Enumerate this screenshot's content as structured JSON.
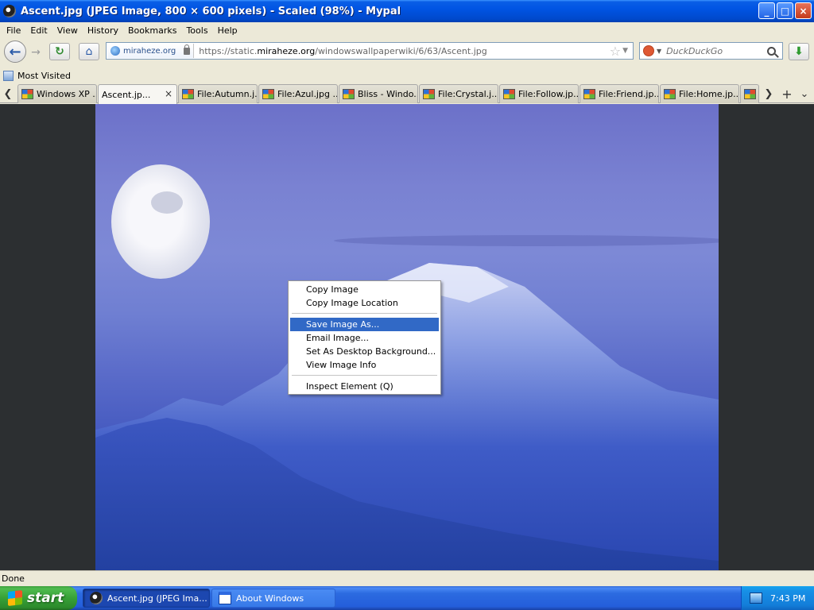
{
  "window": {
    "title": "Ascent.jpg (JPEG Image, 800 × 600 pixels) - Scaled (98%) - Mypal",
    "buttons": {
      "minimize": "_",
      "maximize": "□",
      "close": "×"
    }
  },
  "menubar": {
    "items": [
      {
        "label": "File"
      },
      {
        "label": "Edit"
      },
      {
        "label": "View"
      },
      {
        "label": "History"
      },
      {
        "label": "Bookmarks"
      },
      {
        "label": "Tools"
      },
      {
        "label": "Help"
      }
    ]
  },
  "navbar": {
    "back_glyph": "←",
    "forward_glyph": "→",
    "reload_glyph": "↻",
    "home_glyph": "⌂",
    "site_identity": "miraheze.org",
    "url_prefix": "https://static.",
    "url_host": "miraheze.org",
    "url_path": "/windowswallpaperwiki/6/63/Ascent.jpg",
    "bookmark_star": "☆",
    "url_dropdown": "▼",
    "search_placeholder": "DuckDuckGo",
    "search_dropdown": "▼",
    "download_glyph": "⬇"
  },
  "bookmarks": {
    "items": [
      {
        "label": "Most Visited"
      }
    ]
  },
  "tabs": {
    "scroll_left": "❮",
    "scroll_right": "❯",
    "new_tab": "+",
    "all_tabs": "⌄",
    "close_glyph": "×",
    "items": [
      {
        "label": "Windows XP ...",
        "selected": false,
        "icon": "xp-flag-icon"
      },
      {
        "label": "Ascent.jp...",
        "selected": true,
        "icon": "image-thumbnail-icon"
      },
      {
        "label": "File:Autumn.j...",
        "selected": false,
        "icon": "xp-flag-icon"
      },
      {
        "label": "File:Azul.jpg ...",
        "selected": false,
        "icon": "xp-flag-icon"
      },
      {
        "label": "Bliss - Windo...",
        "selected": false,
        "icon": "xp-flag-icon"
      },
      {
        "label": "File:Crystal.j...",
        "selected": false,
        "icon": "xp-flag-icon"
      },
      {
        "label": "File:Follow.jp...",
        "selected": false,
        "icon": "xp-flag-icon"
      },
      {
        "label": "File:Friend.jp...",
        "selected": false,
        "icon": "xp-flag-icon"
      },
      {
        "label": "File:Home.jp...",
        "selected": false,
        "icon": "xp-flag-icon"
      },
      {
        "label": "F",
        "selected": false,
        "icon": "xp-flag-icon"
      }
    ]
  },
  "context_menu": {
    "groups": [
      [
        {
          "label": "Copy Image",
          "highlighted": false
        },
        {
          "label": "Copy Image Location",
          "highlighted": false
        }
      ],
      [
        {
          "label": "Save Image As...",
          "highlighted": true
        },
        {
          "label": "Email Image...",
          "highlighted": false
        },
        {
          "label": "Set As Desktop Background...",
          "highlighted": false
        },
        {
          "label": "View Image Info",
          "highlighted": false
        }
      ],
      [
        {
          "label": "Inspect Element (Q)",
          "highlighted": false
        }
      ]
    ]
  },
  "statusbar": {
    "text": "Done"
  },
  "taskbar": {
    "start_label": "start",
    "tasks": [
      {
        "label": "Ascent.jpg (JPEG Ima...",
        "active": true,
        "icon": "browser"
      },
      {
        "label": "About Windows",
        "active": false,
        "icon": "window"
      }
    ],
    "clock": "7:43 PM"
  },
  "colors": {
    "titlebar": "#0054e3",
    "menu_highlight": "#3169c6",
    "taskbar": "#245edb",
    "start_button": "#37a137",
    "page_background": "#2c2f31"
  }
}
